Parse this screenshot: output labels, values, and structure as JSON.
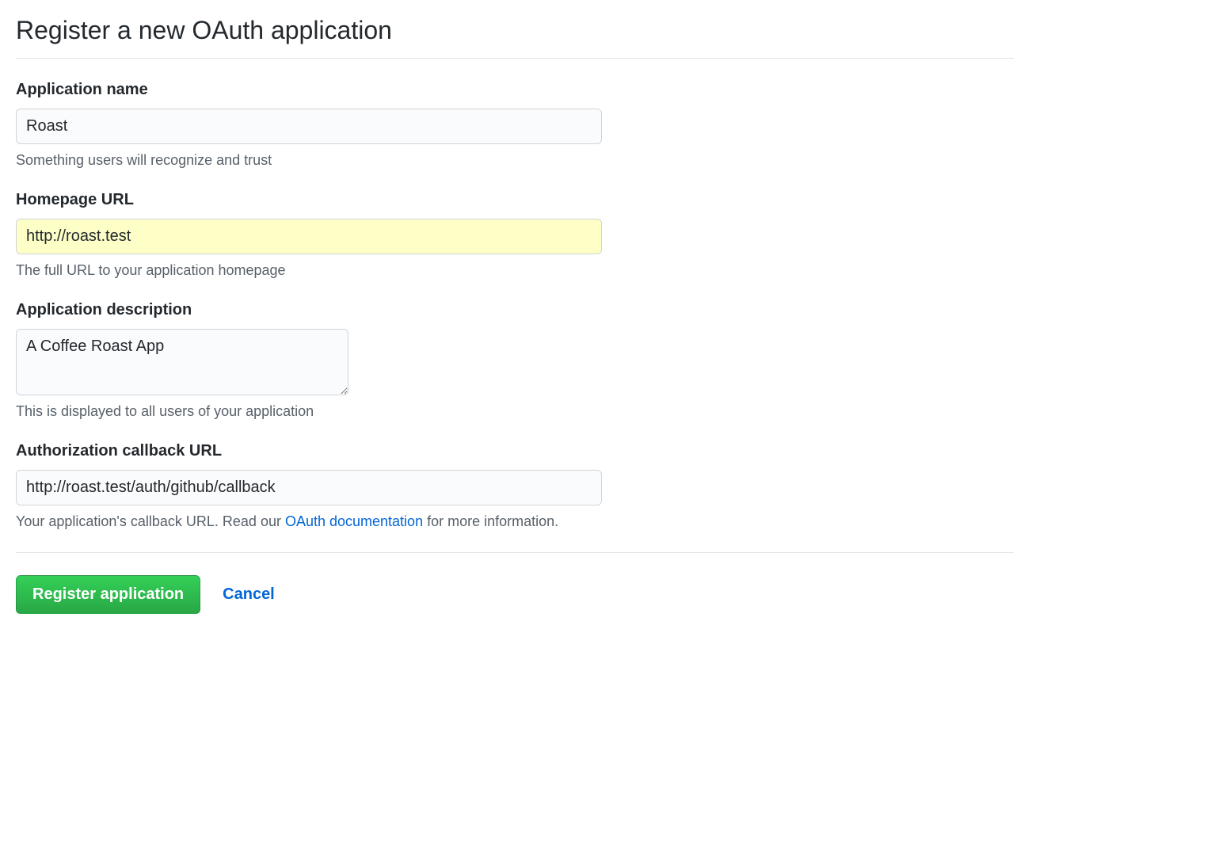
{
  "page": {
    "title": "Register a new OAuth application"
  },
  "form": {
    "app_name": {
      "label": "Application name",
      "value": "Roast",
      "hint": "Something users will recognize and trust"
    },
    "homepage_url": {
      "label": "Homepage URL",
      "value": "http://roast.test",
      "hint": "The full URL to your application homepage"
    },
    "app_description": {
      "label": "Application description",
      "value": "A Coffee Roast App",
      "hint": "This is displayed to all users of your application"
    },
    "callback_url": {
      "label": "Authorization callback URL",
      "value": "http://roast.test/auth/github/callback",
      "hint_prefix": "Your application's callback URL. Read our ",
      "hint_link_text": "OAuth documentation",
      "hint_suffix": " for more information."
    }
  },
  "actions": {
    "register_label": "Register application",
    "cancel_label": "Cancel"
  }
}
